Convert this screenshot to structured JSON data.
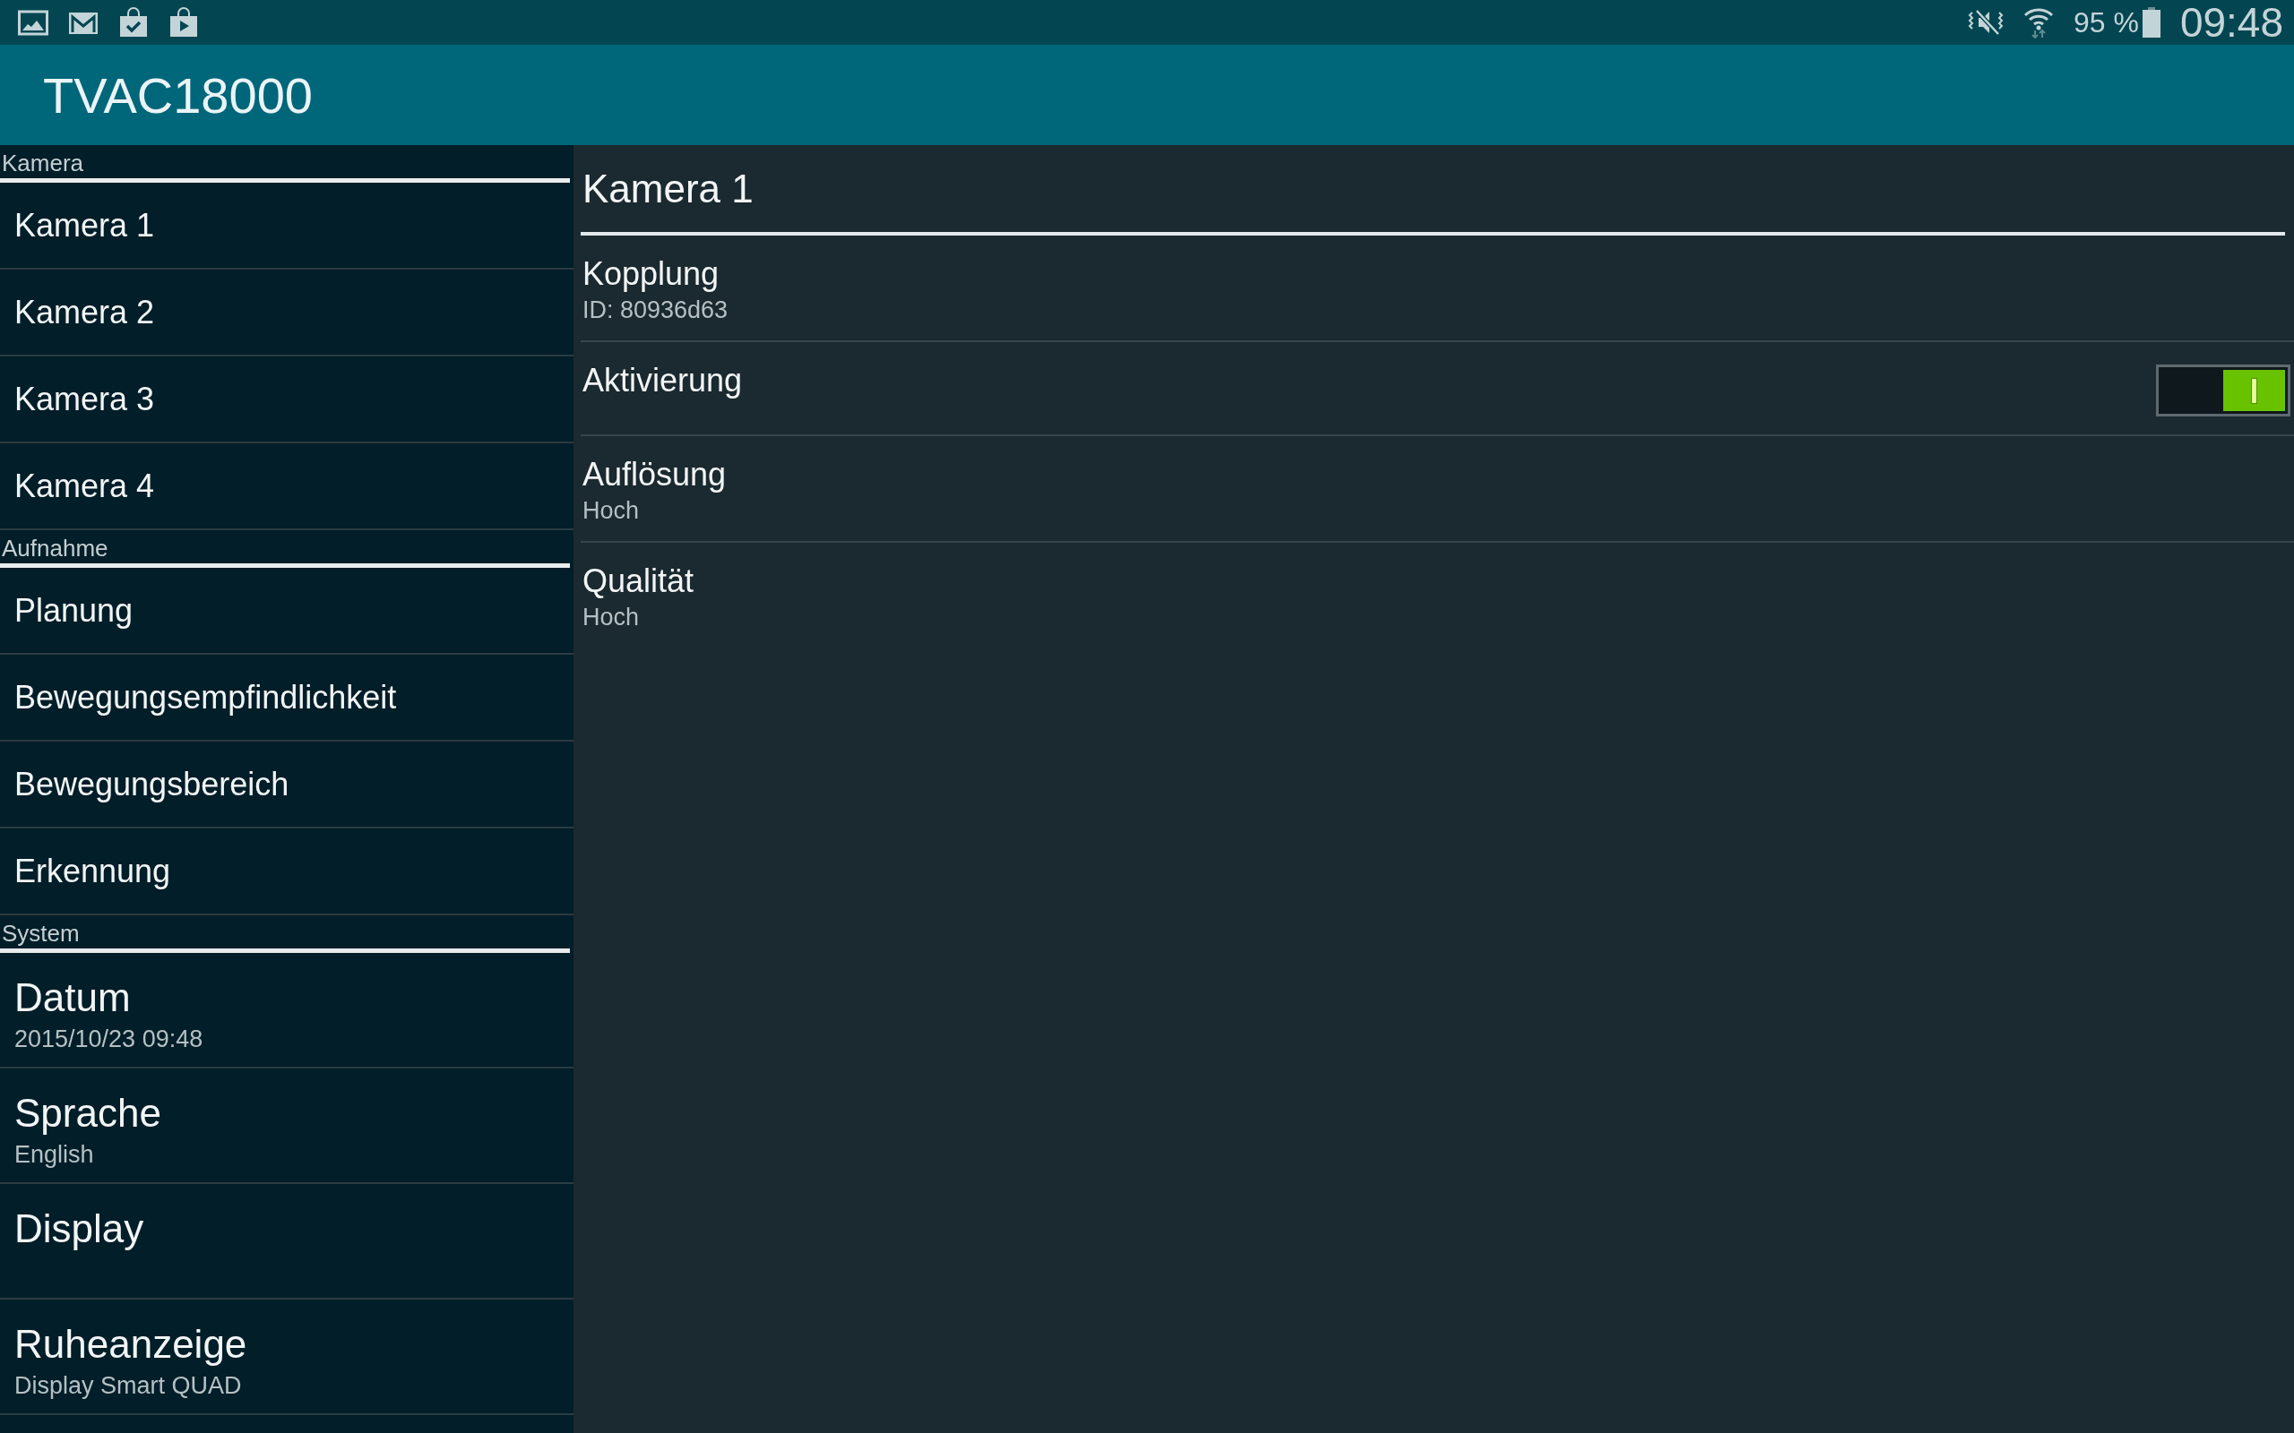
{
  "status_bar": {
    "battery": "95 %",
    "time": "09:48"
  },
  "app_bar": {
    "title": "TVAC18000"
  },
  "sidebar": {
    "sections": [
      {
        "header": "Kamera",
        "kind": "compact",
        "items": [
          {
            "title": "Kamera 1"
          },
          {
            "title": "Kamera 2"
          },
          {
            "title": "Kamera 3"
          },
          {
            "title": "Kamera 4"
          }
        ]
      },
      {
        "header": "Aufnahme",
        "kind": "compact",
        "items": [
          {
            "title": "Planung"
          },
          {
            "title": "Bewegungsempfindlichkeit"
          },
          {
            "title": "Bewegungsbereich"
          },
          {
            "title": "Erkennung"
          }
        ]
      },
      {
        "header": "System",
        "kind": "detailed",
        "items": [
          {
            "title": "Datum",
            "subtitle": "2015/10/23 09:48"
          },
          {
            "title": "Sprache",
            "subtitle": "English"
          },
          {
            "title": "Display"
          },
          {
            "title": "Ruheanzeige",
            "subtitle": "Display Smart QUAD"
          }
        ]
      }
    ]
  },
  "detail": {
    "title": "Kamera 1",
    "settings": [
      {
        "kind": "text",
        "title": "Kopplung",
        "value": "ID: 80936d63"
      },
      {
        "kind": "toggle",
        "title": "Aktivierung",
        "on": true
      },
      {
        "kind": "text",
        "title": "Auflösung",
        "value": "Hoch"
      },
      {
        "kind": "text",
        "title": "Qualität",
        "value": "Hoch"
      }
    ]
  }
}
